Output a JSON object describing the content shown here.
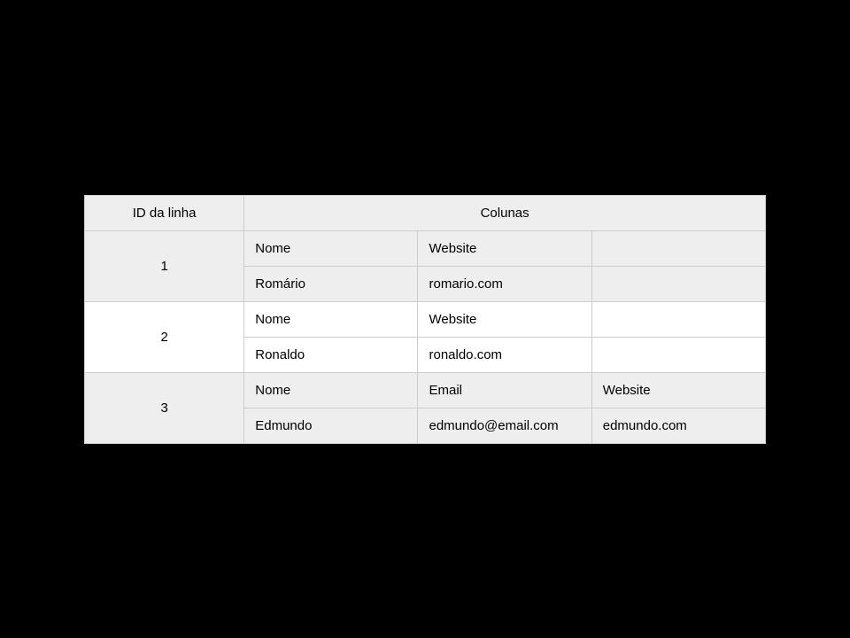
{
  "header": {
    "id_label": "ID da linha",
    "columns_label": "Colunas"
  },
  "rows": [
    {
      "id": "1",
      "labels": {
        "c1": "Nome",
        "c2": "Website",
        "c3": ""
      },
      "values": {
        "c1": "Romário",
        "c2": "romario.com",
        "c3": ""
      }
    },
    {
      "id": "2",
      "labels": {
        "c1": "Nome",
        "c2": "Website",
        "c3": ""
      },
      "values": {
        "c1": "Ronaldo",
        "c2": "ronaldo.com",
        "c3": ""
      }
    },
    {
      "id": "3",
      "labels": {
        "c1": "Nome",
        "c2": "Email",
        "c3": "Website"
      },
      "values": {
        "c1": "Edmundo",
        "c2": "edmundo@email.com",
        "c3": "edmundo.com"
      }
    }
  ]
}
